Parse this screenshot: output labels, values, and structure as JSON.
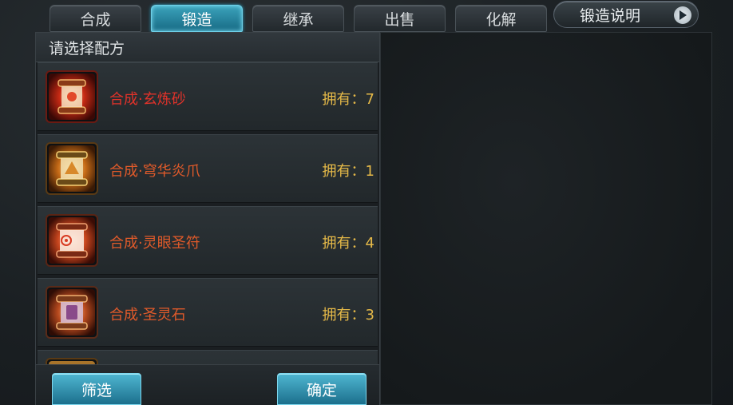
{
  "tabs": [
    {
      "label": "合成",
      "active": false
    },
    {
      "label": "锻造",
      "active": true
    },
    {
      "label": "继承",
      "active": false
    },
    {
      "label": "出售",
      "active": false
    },
    {
      "label": "化解",
      "active": false
    }
  ],
  "explain_button": {
    "label": "锻造说明",
    "icon": "play-icon"
  },
  "recipe_panel": {
    "title": "请选择配方",
    "items": [
      {
        "name": "合成·玄炼砂",
        "owned": "拥有：7",
        "icon": "scroll-red-icon"
      },
      {
        "name": "合成·穹华炎爪",
        "owned": "拥有：1",
        "icon": "scroll-gold-icon"
      },
      {
        "name": "合成·灵眼圣符",
        "owned": "拥有：4",
        "icon": "scroll-talisman-icon"
      },
      {
        "name": "合成·圣灵石",
        "owned": "拥有：3",
        "icon": "scroll-stone-icon"
      }
    ]
  },
  "actions": {
    "filter_label": "筛选",
    "confirm_label": "确定"
  },
  "colors": {
    "tab_active": "#2a8fab",
    "item_name_red": "#e0322a",
    "item_name_orange": "#e05a2a",
    "owned_gold": "#e5b948"
  }
}
